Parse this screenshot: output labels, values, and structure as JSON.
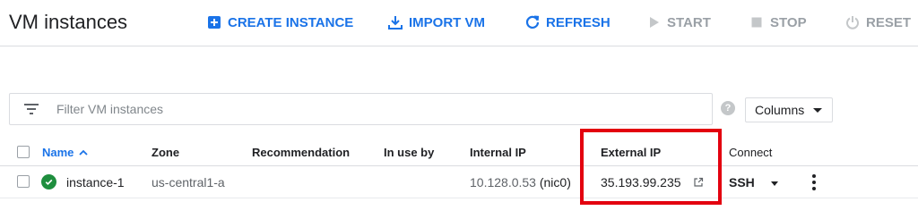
{
  "header": {
    "title": "VM instances",
    "actions": {
      "create": "CREATE INSTANCE",
      "import": "IMPORT VM",
      "refresh": "REFRESH",
      "start": "START",
      "stop": "STOP",
      "reset": "RESET"
    }
  },
  "filter": {
    "placeholder": "Filter VM instances",
    "columns_label": "Columns",
    "help_glyph": "?"
  },
  "table": {
    "columns": {
      "name": "Name",
      "zone": "Zone",
      "recommendation": "Recommendation",
      "in_use_by": "In use by",
      "internal_ip": "Internal IP",
      "external_ip": "External IP",
      "connect": "Connect"
    },
    "rows": [
      {
        "name": "instance-1",
        "status": "running",
        "zone": "us-central1-a",
        "recommendation": "",
        "in_use_by": "",
        "internal_ip": "10.128.0.53",
        "internal_ip_nic": "(nic0)",
        "external_ip": "35.193.99.235",
        "connect": "SSH"
      }
    ]
  },
  "colors": {
    "accent": "#1a73e8",
    "status_ok": "#1e8e3e",
    "highlight": "#e3000f",
    "disabled": "#9aa0a6"
  },
  "icons": {
    "create": "add-box-icon",
    "import": "import-icon",
    "refresh": "refresh-icon",
    "start": "play-icon",
    "stop": "stop-icon",
    "reset": "power-icon",
    "filter": "filter-icon",
    "help": "help-icon",
    "status": "check-circle-icon",
    "external_link": "external-link-icon",
    "more": "more-vert-icon"
  }
}
